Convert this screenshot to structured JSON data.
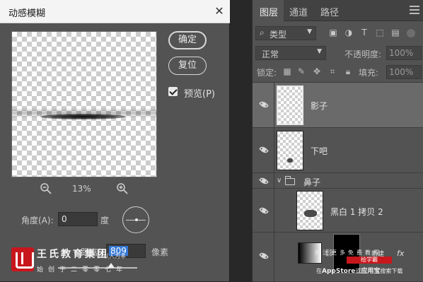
{
  "dialog": {
    "title": "动感模糊",
    "buttons": {
      "ok": "确定",
      "reset": "复位"
    },
    "preview_label": "预览(P)",
    "preview_checked": true,
    "zoom": "13%",
    "angle_label": "角度(A):",
    "angle_value": "0",
    "angle_unit": "度",
    "distance_label": "距离(D):",
    "distance_value": "809",
    "distance_unit": "像素",
    "distance_slider_position": 0.92
  },
  "watermark": {
    "name": "王氏教育集团",
    "tagline": "以人为本",
    "founded": "始创于二零零七年",
    "right_line1": "关注更多免费教程",
    "right_mid": "绘学霸",
    "right_line2_prefix": "在",
    "right_line2_appstore": "AppStore",
    "right_line2_or": "或",
    "right_line2_store": "应用宝",
    "right_line2_suffix": "搜索下载",
    "footer_text": "新建"
  },
  "panel": {
    "tabs": [
      "图层",
      "通道",
      "路径"
    ],
    "active_tab": "图层",
    "filter": {
      "kind": "类型"
    },
    "blend_mode": "正常",
    "opacity_label": "不透明度:",
    "opacity_value": "100%",
    "lock_label": "锁定:",
    "fill_label": "填充:",
    "fill_value": "100%",
    "layers": [
      {
        "name": "影子",
        "selected": true,
        "visible": true
      },
      {
        "name": "下吧",
        "selected": false,
        "visible": true
      },
      {
        "name": "鼻子",
        "type": "group",
        "expanded": true,
        "visible": true
      },
      {
        "name": "黑白 1 拷贝 2",
        "selected": false,
        "visible": true
      },
      {
        "name": "渐变...",
        "type": "adjustment",
        "visible": true
      }
    ]
  },
  "colors": {
    "panel_bg": "#535353",
    "selected_layer": "#6a6a6a",
    "input_highlight": "#3478d6",
    "watermark_red": "#c8161d"
  }
}
